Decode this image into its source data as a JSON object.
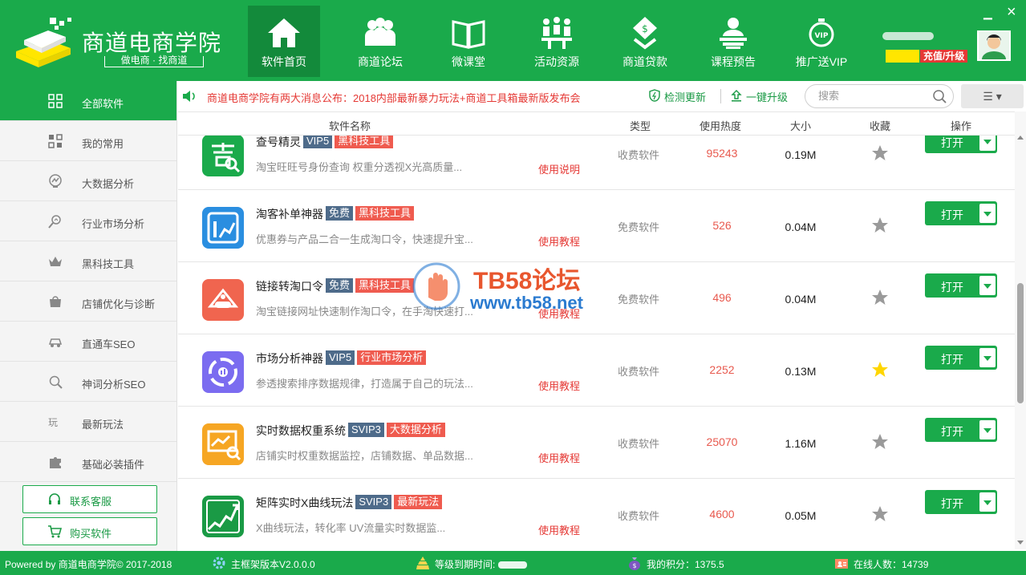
{
  "header": {
    "logo_title": "商道电商学院",
    "logo_sub": "做电商 · 找商道",
    "nav": [
      {
        "label": "软件首页",
        "icon": "home-icon"
      },
      {
        "label": "商道论坛",
        "icon": "forum-people-icon"
      },
      {
        "label": "微课堂",
        "icon": "book-icon"
      },
      {
        "label": "活动资源",
        "icon": "meeting-icon"
      },
      {
        "label": "商道贷款",
        "icon": "loan-icon"
      },
      {
        "label": "课程预告",
        "icon": "course-icon"
      },
      {
        "label": "推广送VIP",
        "icon": "vip-timer-icon"
      }
    ],
    "recharge_label": "充值/升级",
    "minimize": "×",
    "close": "✕"
  },
  "sidebar": {
    "items": [
      {
        "label": "全部软件",
        "icon": "grid-icon"
      },
      {
        "label": "我的常用",
        "icon": "apps-icon"
      },
      {
        "label": "大数据分析",
        "icon": "data-icon"
      },
      {
        "label": "行业市场分析",
        "icon": "market-icon"
      },
      {
        "label": "黑科技工具",
        "icon": "crown-icon"
      },
      {
        "label": "店铺优化与诊断",
        "icon": "shop-icon"
      },
      {
        "label": "直通车SEO",
        "icon": "car-icon"
      },
      {
        "label": "神词分析SEO",
        "icon": "search-icon"
      },
      {
        "label": "最新玩法",
        "icon": "play-icon"
      },
      {
        "label": "基础必装插件",
        "icon": "puzzle-icon"
      }
    ],
    "service_label": "联系客服",
    "buy_label": "购买软件"
  },
  "notice": {
    "text": "商道电商学院有两大消息公布：2018内部最新暴力玩法+商道工具箱最新版发布会",
    "check_update": "检测更新",
    "one_key_upgrade": "一键升级",
    "search_placeholder": "搜索",
    "view_toggle": "☰ ▾"
  },
  "table": {
    "headers": {
      "name": "软件名称",
      "type": "类型",
      "heat": "使用热度",
      "size": "大小",
      "fav": "收藏",
      "op": "操作"
    },
    "rows": [
      {
        "name": "查号精灵",
        "level": "VIP5",
        "category": "黑科技工具",
        "desc": "淘宝旺旺号身份查询  权重分透视X光高质量...",
        "help": "使用说明",
        "type": "收费软件",
        "heat": "95243",
        "size": "0.19M",
        "favorited": false,
        "open": "打开",
        "color": "#1aaa4b"
      },
      {
        "name": "淘客补单神器",
        "level": "免费",
        "category": "黑科技工具",
        "desc": "优惠券与产品二合一生成淘口令，快速提升宝...",
        "help": "使用教程",
        "type": "免费软件",
        "heat": "526",
        "size": "0.04M",
        "favorited": false,
        "open": "打开",
        "color": "#2a8ee0"
      },
      {
        "name": "链接转淘口令",
        "level": "免费",
        "category": "黑科技工具",
        "desc": "淘宝链接网址快速制作淘口令，在手淘快速打...",
        "help": "使用教程",
        "type": "免费软件",
        "heat": "496",
        "size": "0.04M",
        "favorited": false,
        "open": "打开",
        "color": "#f0654f"
      },
      {
        "name": "市场分析神器",
        "level": "VIP5",
        "category": "行业市场分析",
        "desc": "参透搜索排序数据规律，打造属于自己的玩法...",
        "help": "使用教程",
        "type": "收费软件",
        "heat": "2252",
        "size": "0.13M",
        "favorited": true,
        "open": "打开",
        "color": "#7b6cf0"
      },
      {
        "name": "实时数据权重系统",
        "level": "SVIP3",
        "category": "大数据分析",
        "desc": "店铺实时权重数据监控，店铺数据、单品数据...",
        "help": "使用教程",
        "type": "收费软件",
        "heat": "25070",
        "size": "1.16M",
        "favorited": false,
        "open": "打开",
        "color": "#f6a623"
      },
      {
        "name": "矩阵实时X曲线玩法",
        "level": "SVIP3",
        "category": "最新玩法",
        "desc": "X曲线玩法，转化率  UV流量实时数据监...",
        "help": "使用教程",
        "type": "收费软件",
        "heat": "4600",
        "size": "0.05M",
        "favorited": false,
        "open": "打开",
        "color": "#1a9a45"
      }
    ]
  },
  "watermark": {
    "title": "TB58论坛",
    "url": "www.tb58.net"
  },
  "footer": {
    "copyright": "Powered by 商道电商学院© 2017-2018",
    "version": "主框架版本V2.0.0.0",
    "expiry_label": "等级到期时间:",
    "points": "我的积分：1375.5",
    "online": "在线人数：14739"
  }
}
